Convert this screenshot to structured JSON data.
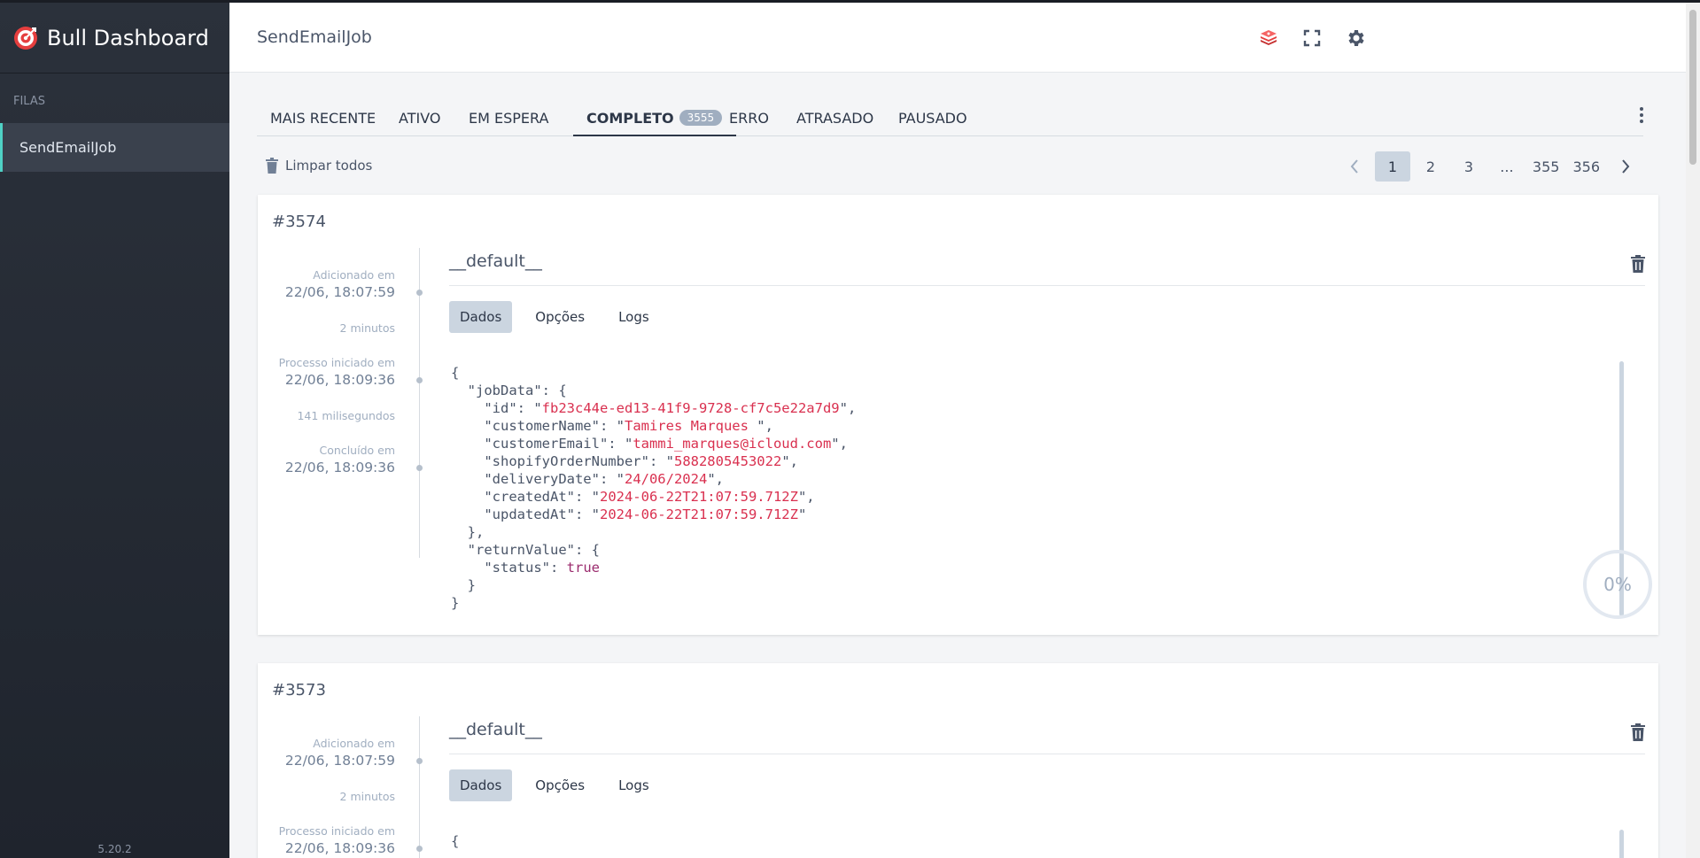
{
  "sidebar": {
    "brand": "Bull Dashboard",
    "queues_label": "FILAS",
    "queues": [
      "SendEmailJob"
    ],
    "version": "5.20.2"
  },
  "header": {
    "title": "SendEmailJob",
    "icons": [
      "redis-icon",
      "fullscreen-icon",
      "settings-icon"
    ]
  },
  "tabs": [
    {
      "label": "MAIS RECENTE"
    },
    {
      "label": "ATIVO"
    },
    {
      "label": "EM ESPERA"
    },
    {
      "label": "COMPLETO",
      "count": "3555",
      "active": true
    },
    {
      "label": "ERRO"
    },
    {
      "label": "ATRASADO"
    },
    {
      "label": "PAUSADO"
    }
  ],
  "toolbar": {
    "clean_label": "Limpar todos",
    "pages": [
      "1",
      "2",
      "3",
      "...",
      "355",
      "356"
    ],
    "current_page": "1"
  },
  "jobs": [
    {
      "id": "#3574",
      "name": "__default__",
      "added_label": "Adicionado em",
      "added_time": "22/06, 18:07:59",
      "wait_duration": "2 minutos",
      "started_label": "Processo iniciado em",
      "started_time": "22/06, 18:09:36",
      "process_duration": "141 milisegundos",
      "finished_label": "Concluído em",
      "finished_time": "22/06, 18:09:36",
      "subtabs": [
        "Dados",
        "Opções",
        "Logs"
      ],
      "data": {
        "id": "fb23c44e-ed13-41f9-9728-cf7c5e22a7d9",
        "customerName": "Tamires Marques ",
        "customerEmail": "tammi_marques@icloud.com",
        "shopifyOrderNumber": "5882805453022",
        "deliveryDate": "24/06/2024",
        "createdAt": "2024-06-22T21:07:59.712Z",
        "updatedAt": "2024-06-22T21:07:59.712Z",
        "status": "true"
      },
      "progress": "0%"
    },
    {
      "id": "#3573",
      "name": "__default__",
      "added_label": "Adicionado em",
      "added_time": "22/06, 18:07:59",
      "wait_duration": "2 minutos",
      "started_label": "Processo iniciado em",
      "started_time": "22/06, 18:09:36",
      "subtabs": [
        "Dados",
        "Opções",
        "Logs"
      ]
    }
  ],
  "colors": {
    "accent": "#4fd1c5",
    "json_string": "#d9304f",
    "json_boolean": "#9b2c6e",
    "sidebar_bg": "#2b313b"
  }
}
